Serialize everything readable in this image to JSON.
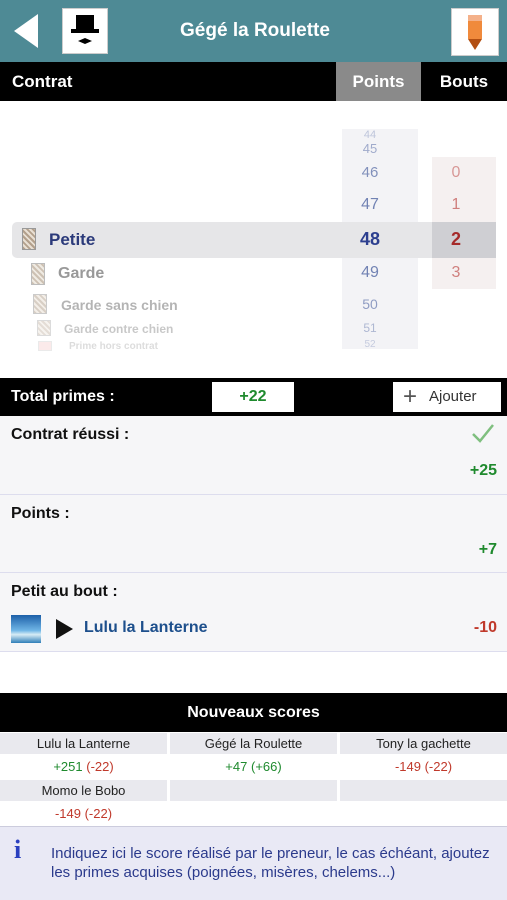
{
  "header": {
    "title": "Gégé la Roulette",
    "back_icon": "back-arrow-icon",
    "avatar_icon": "top-hat-avatar-icon",
    "edit_icon": "pencil-icon"
  },
  "tabs": {
    "contrat": "Contrat",
    "points": "Points",
    "bouts": "Bouts",
    "active": "Points"
  },
  "picker": {
    "points": [
      "44",
      "45",
      "46",
      "47",
      "48",
      "49",
      "50",
      "51",
      "52"
    ],
    "bouts": [
      "0",
      "1",
      "2",
      "3"
    ],
    "contracts": [
      "Petite",
      "Garde",
      "Garde sans chien",
      "Garde contre chien",
      "Prime hors contrat"
    ],
    "selected_contract": "Petite",
    "selected_points": "48",
    "selected_bouts": "2"
  },
  "primes": {
    "label": "Total primes :",
    "value": "+22",
    "add_label": "Ajouter"
  },
  "sections": {
    "contrat_reussi": {
      "label": "Contrat réussi :",
      "value": "+25",
      "check_icon": "checkmark-icon"
    },
    "points": {
      "label": "Points :",
      "value": "+7"
    },
    "petit_au_bout": {
      "label": "Petit au bout :",
      "player": "Lulu la Lanterne",
      "value": "-10",
      "play_icon": "play-icon"
    }
  },
  "scores": {
    "title": "Nouveaux scores",
    "players": [
      {
        "name": "Lulu la Lanterne",
        "score": "+251",
        "delta": "(-22)",
        "color": "#1f8a2e"
      },
      {
        "name": "Gégé la Roulette",
        "score": "+47",
        "delta": "(+66)",
        "color": "#1f8a2e"
      },
      {
        "name": "Tony la gachette",
        "score": "-149",
        "delta": "(-22)",
        "color": "#c0392b"
      },
      {
        "name": "Momo le Bobo",
        "score": "-149",
        "delta": "(-22)",
        "color": "#c0392b"
      }
    ]
  },
  "info": {
    "text": "Indiquez ici le score réalisé par le preneur, le cas échéant, ajoutez les primes acquises (poignées, misères, chelems...)",
    "icon": "info-icon"
  },
  "colors": {
    "header": "#4e8a95",
    "positive": "#1f8a2e",
    "negative": "#c0392b",
    "link": "#1d4f8c"
  }
}
